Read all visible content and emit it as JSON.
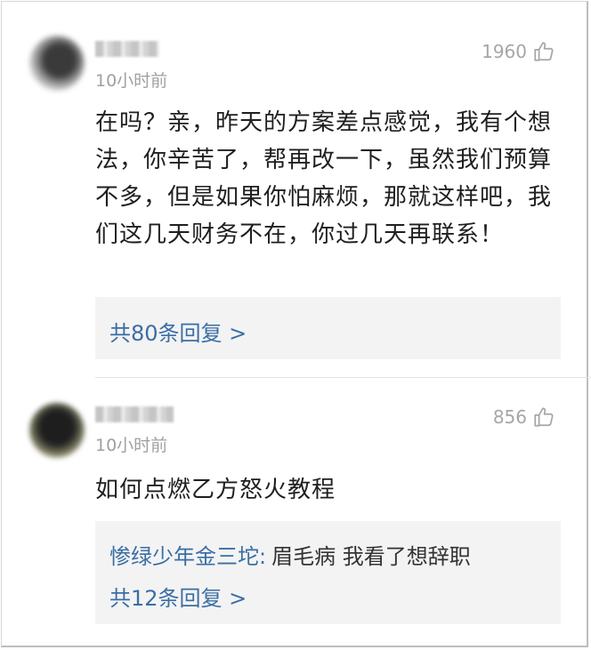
{
  "comments": [
    {
      "time": "10小时前",
      "likes": "1960",
      "text": "在吗？亲，昨天的方案差点感觉，我有个想法，你辛苦了，帮再改一下，虽然我们预算不多，但是如果你怕麻烦，那就这样吧，我们这几天财务不在，你过几天再联系！",
      "reply_count_label": "共80条回复 >"
    },
    {
      "time": "10小时前",
      "likes": "856",
      "text": "如何点燃乙方怒火教程",
      "sub_reply": {
        "author": "惨绿少年金三坨:",
        "text": "眉毛病 我看了想辞职"
      },
      "reply_count_label": "共12条回复 >"
    }
  ],
  "icons": {
    "like": "thumbs-up-icon"
  },
  "colors": {
    "link": "#3a6ea5",
    "reply_bg": "#f3f3f3",
    "meta": "#a0a0a0"
  }
}
